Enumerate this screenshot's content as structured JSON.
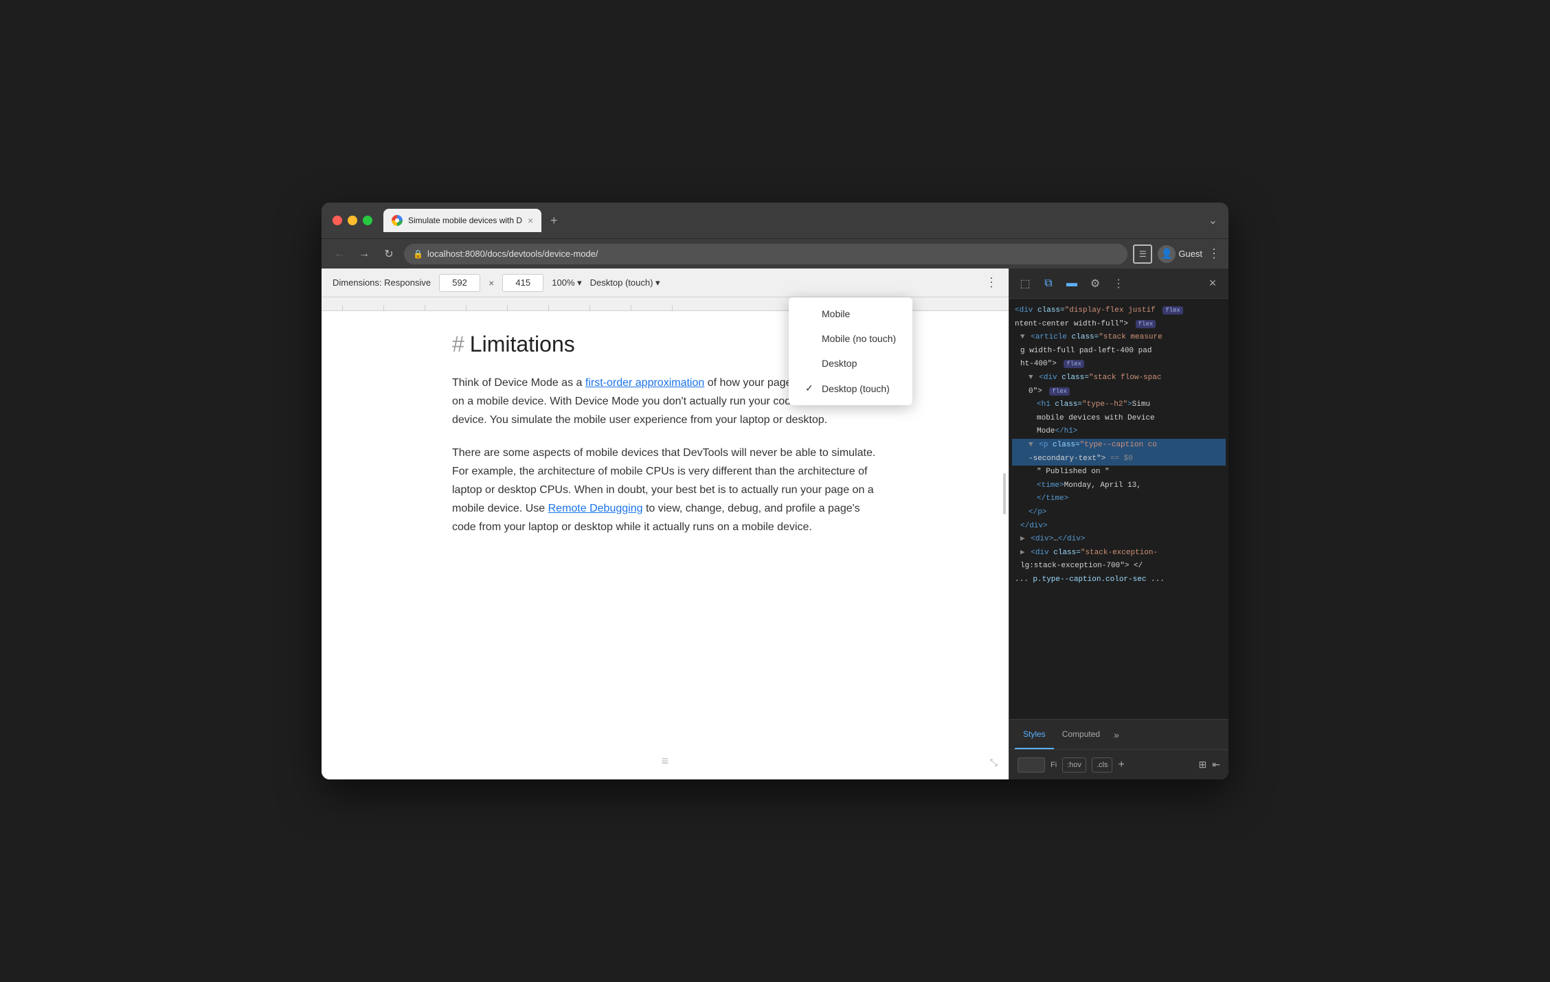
{
  "window": {
    "title": "Simulate mobile devices with D"
  },
  "titlebar": {
    "tab_title": "Simulate mobile devices with D",
    "close_label": "×",
    "new_tab_label": "+",
    "profile_name": "Guest",
    "chevron": "⌄"
  },
  "navbar": {
    "back_label": "←",
    "forward_label": "→",
    "reload_label": "↻",
    "address": "localhost:8080/docs/devtools/device-mode/",
    "menu_label": "⋮"
  },
  "device_toolbar": {
    "dimensions_label": "Dimensions: Responsive",
    "width_value": "592",
    "height_value": "415",
    "zoom_label": "100% ▾",
    "device_label": "Desktop (touch) ▾",
    "more_label": "⋮"
  },
  "device_dropdown": {
    "items": [
      {
        "id": "mobile",
        "label": "Mobile",
        "checked": false
      },
      {
        "id": "mobile-no-touch",
        "label": "Mobile (no touch)",
        "checked": false
      },
      {
        "id": "desktop",
        "label": "Desktop",
        "checked": false
      },
      {
        "id": "desktop-touch",
        "label": "Desktop (touch)",
        "checked": true
      }
    ]
  },
  "page": {
    "heading": "Limitations",
    "hash": "#",
    "paragraph1_part1": "Think of Device Mode as a ",
    "paragraph1_link": "first-order approximation",
    "paragraph1_part2": " of how your page looks and feels on a mobile device. With Device Mode you don't actually run your code on a mobile device. You simulate the mobile user experience from your laptop or desktop.",
    "paragraph2_part1": "There are some aspects of mobile devices that DevTools will never be able to simulate. For example, the architecture of mobile CPUs is very different than the architecture of laptop or desktop CPUs. When in doubt, your best bet is to actually run your page on a mobile device. Use ",
    "paragraph2_link": "Remote Debugging",
    "paragraph2_part2": " to view, change, debug, and profile a page's code from your laptop or desktop while it actually runs on a mobile device."
  },
  "devtools": {
    "toolbar_buttons": [
      "cursor-icon",
      "mobile-icon",
      "elements-icon",
      "settings-icon",
      "more-icon"
    ],
    "html_lines": [
      {
        "indent": 0,
        "content": "<div class=\"display-flex justif",
        "has_flex": true
      },
      {
        "indent": 0,
        "content": "ntent-center width-full\">",
        "has_flex": false
      },
      {
        "indent": 1,
        "content": "<article class=\"stack measure",
        "has_flex": false
      },
      {
        "indent": 1,
        "content": "g width-full pad-left-400 pad",
        "has_flex": false
      },
      {
        "indent": 1,
        "content": "ht-400\">",
        "has_flex": true
      },
      {
        "indent": 2,
        "content": "<div class=\"stack flow-spac",
        "has_flex": false
      },
      {
        "indent": 2,
        "content": "0\">",
        "has_flex": true
      },
      {
        "indent": 3,
        "content": "<h1 class=\"type--h2\">Simu",
        "has_flex": false
      },
      {
        "indent": 3,
        "content": "mobile devices with Device",
        "has_flex": false
      },
      {
        "indent": 3,
        "content": "Mode</h1>",
        "has_flex": false
      },
      {
        "indent": 2,
        "content": "<p class=\"type--caption co",
        "has_flex": false
      },
      {
        "indent": 2,
        "content": "-secondary-text\"> == $0",
        "is_selected": true,
        "has_flex": false
      },
      {
        "indent": 3,
        "content": "\" Published on \"",
        "has_flex": false
      },
      {
        "indent": 3,
        "content": "<time>Monday, April 13,",
        "has_flex": false
      },
      {
        "indent": 3,
        "content": "</time>",
        "has_flex": false
      },
      {
        "indent": 2,
        "content": "</p>",
        "has_flex": false
      },
      {
        "indent": 1,
        "content": "</div>",
        "has_flex": false
      },
      {
        "indent": 1,
        "content": "<div>…</div>",
        "has_flex": false
      },
      {
        "indent": 1,
        "content": "<div class=\"stack-exception-",
        "has_flex": false
      },
      {
        "indent": 1,
        "content": "lg:stack-exception-700\"> </",
        "has_flex": false
      },
      {
        "indent": 0,
        "content": "... p.type--caption.color-sec ...",
        "has_flex": false
      }
    ],
    "tabs": [
      {
        "id": "styles",
        "label": "Styles",
        "active": true
      },
      {
        "id": "computed",
        "label": "Computed",
        "active": false
      }
    ],
    "tab_more": "»",
    "footer": {
      "filter_placeholder": "Fi",
      "hov_label": ":hov",
      "cls_label": ".cls",
      "plus_label": "+"
    }
  }
}
